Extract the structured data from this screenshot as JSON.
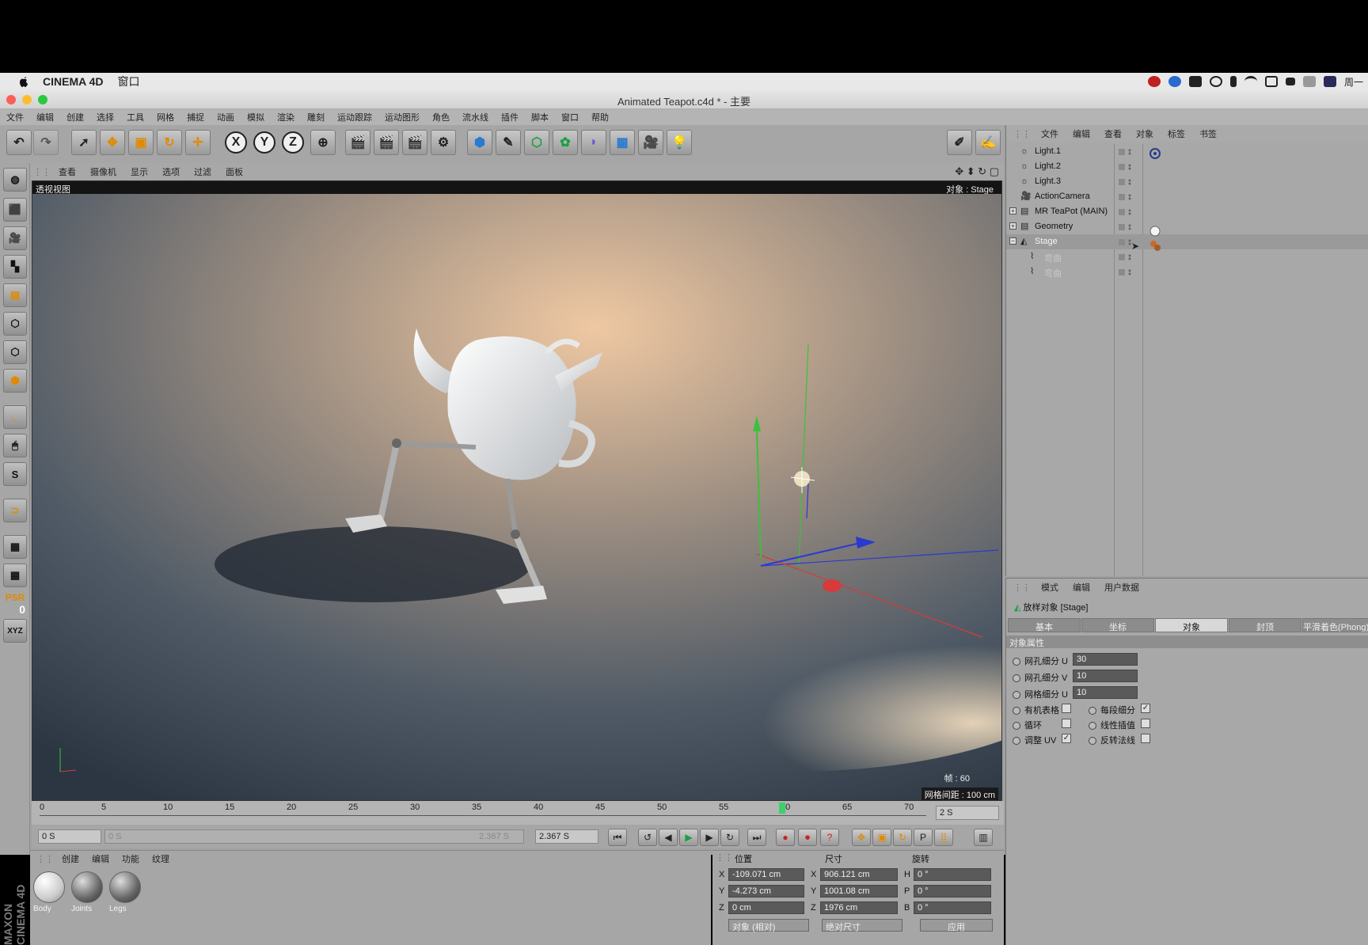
{
  "menubar": {
    "app_name": "CINEMA 4D",
    "window_menu": "窗口",
    "right_end": "周一"
  },
  "window": {
    "title": "Animated Teapot.c4d * - 主要"
  },
  "main_menu": [
    "文件",
    "编辑",
    "创建",
    "选择",
    "工具",
    "网格",
    "捕捉",
    "动画",
    "模拟",
    "渲染",
    "雕刻",
    "运动跟踪",
    "运动图形",
    "角色",
    "流水线",
    "插件",
    "脚本",
    "窗口",
    "帮助"
  ],
  "toolbar": {
    "axis_x": "X",
    "axis_y": "Y",
    "axis_z": "Z"
  },
  "left_tools": {
    "psr_label": "PSR",
    "psr_value": "0",
    "xyz_label": "XYZ"
  },
  "viewport": {
    "menu": [
      "查看",
      "摄像机",
      "显示",
      "选项",
      "过滤",
      "面板"
    ],
    "label": "透视视图",
    "object": "对象 : Stage",
    "frame": "帧 : 60",
    "grid_spacing": "网格间距 : 100 cm"
  },
  "timeline": {
    "ticks": [
      "0",
      "5",
      "10",
      "15",
      "20",
      "25",
      "30",
      "35",
      "40",
      "45",
      "50",
      "55",
      "60",
      "65",
      "70"
    ],
    "end_field": "2 S",
    "current_frame": 60
  },
  "playback": {
    "start": "0 S",
    "range_start": "0 S",
    "range_end": "2.367 S",
    "end": "2.367 S"
  },
  "material_manager": {
    "menu": [
      "创建",
      "编辑",
      "功能",
      "纹理"
    ],
    "materials": [
      "Body",
      "Joints",
      "Legs"
    ]
  },
  "coordinates": {
    "headers": {
      "position": "位置",
      "size": "尺寸",
      "rotation": "旋转"
    },
    "rows": [
      {
        "axis": "X",
        "pos": "-109.071 cm",
        "size_axis": "X",
        "size": "906.121 cm",
        "rot_axis": "H",
        "rot": "0 °"
      },
      {
        "axis": "Y",
        "pos": "-4.273 cm",
        "size_axis": "Y",
        "size": "1001.08 cm",
        "rot_axis": "P",
        "rot": "0 °"
      },
      {
        "axis": "Z",
        "pos": "0 cm",
        "size_axis": "Z",
        "size": "1976 cm",
        "rot_axis": "B",
        "rot": "0 °"
      }
    ],
    "mode_object": "对象 (相对)",
    "mode_size": "绝对尺寸",
    "apply": "应用"
  },
  "object_manager": {
    "menu": [
      "文件",
      "编辑",
      "查看",
      "对象",
      "标签",
      "书签"
    ],
    "objects": [
      {
        "name": "Light.1",
        "color": "#111111"
      },
      {
        "name": "Light.2",
        "color": "#111111"
      },
      {
        "name": "Light.3",
        "color": "#111111"
      },
      {
        "name": "ActionCamera",
        "color": "#111111"
      },
      {
        "name": "MR TeaPot (MAIN)",
        "color": "#111111"
      },
      {
        "name": "Geometry",
        "color": "#111111"
      },
      {
        "name": "Stage",
        "color": "#f4f4f4"
      },
      {
        "name": "弯曲",
        "color": "#c8c8c8"
      },
      {
        "name": "弯曲",
        "color": "#c8c8c8"
      }
    ]
  },
  "attribute_manager": {
    "menu": [
      "模式",
      "编辑",
      "用户数据"
    ],
    "object_title": "放样对象 [Stage]",
    "tabs": [
      "基本",
      "坐标",
      "对象",
      "封顶",
      "平滑着色(Phong)"
    ],
    "active_tab": "对象",
    "section": "对象属性",
    "mesh_u_label": "网孔细分 U",
    "mesh_u_value": "30",
    "mesh_v_label": "网孔细分 V",
    "mesh_v_value": "10",
    "grid_u_label": "网格细分 U",
    "grid_u_value": "10",
    "organic_label": "有机表格",
    "each_seg_label": "每段细分",
    "loop_label": "循环",
    "linear_label": "线性插值",
    "adjust_uv_label": "调整 UV",
    "flip_normals_label": "反转法线"
  },
  "branding": "MAXON CINEMA 4D"
}
